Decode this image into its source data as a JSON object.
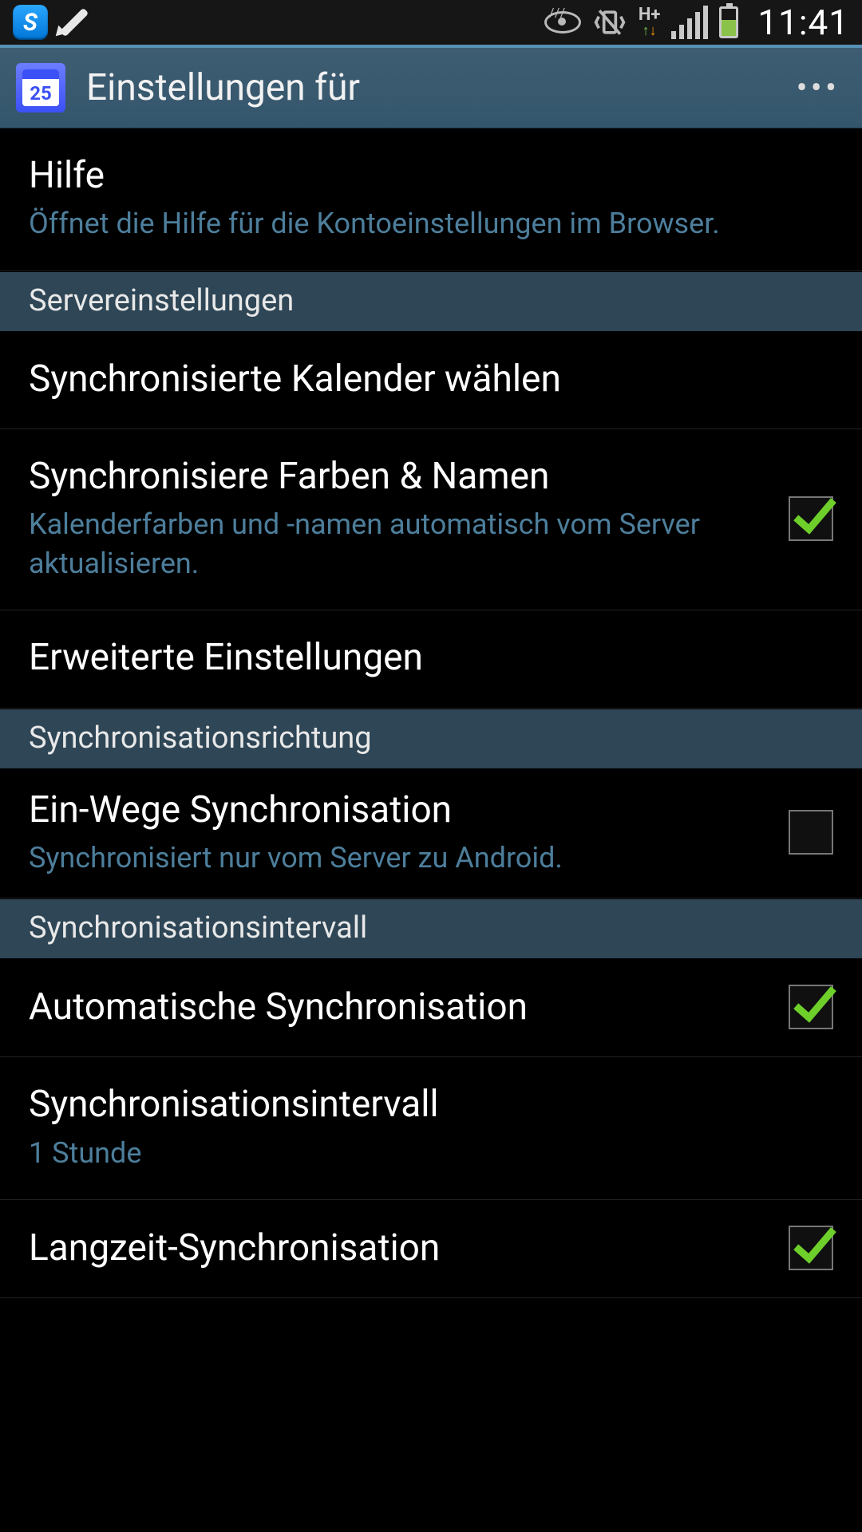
{
  "statusbar": {
    "time": "11:41",
    "network": "H+",
    "app_badge": "S",
    "cal_day": "25"
  },
  "header": {
    "title": "Einstellungen für "
  },
  "sections": {
    "help": {
      "title": "Hilfe",
      "sub": "Öffnet die Hilfe für die Kontoeinstellungen im Browser."
    },
    "server_header": "Servereinstellungen",
    "choose_calendars": {
      "title": "Synchronisierte Kalender wählen"
    },
    "sync_colors": {
      "title": "Synchronisiere Farben & Namen",
      "sub": "Kalenderfarben und -namen automatisch vom Server aktualisieren.",
      "checked": true
    },
    "advanced": {
      "title": "Erweiterte Einstellungen"
    },
    "direction_header": "Synchronisationsrichtung",
    "one_way": {
      "title": "Ein-Wege Synchronisation",
      "sub": "Synchronisiert nur vom Server zu Android.",
      "checked": false
    },
    "interval_header": "Synchronisationsintervall",
    "auto_sync": {
      "title": "Automatische Synchronisation",
      "checked": true
    },
    "interval": {
      "title": "Synchronisationsintervall",
      "sub": "1 Stunde"
    },
    "long_term": {
      "title": "Langzeit-Synchronisation",
      "checked": true
    }
  }
}
